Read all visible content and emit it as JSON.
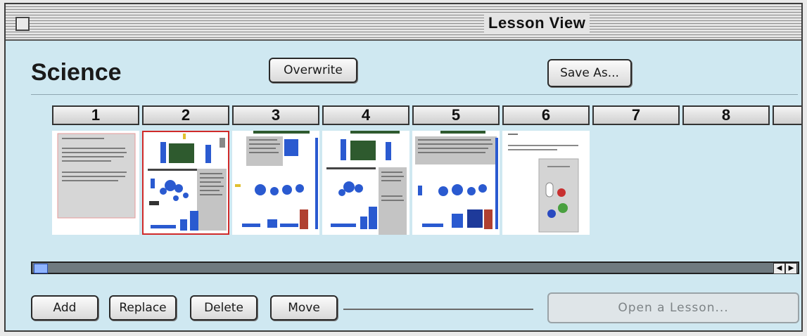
{
  "window": {
    "title": "Lesson View"
  },
  "subject": "Science",
  "buttons": {
    "overwrite": "Overwrite",
    "save_as": "Save As...",
    "add": "Add",
    "replace": "Replace",
    "delete": "Delete",
    "move": "Move",
    "open_lesson": "Open a Lesson..."
  },
  "columns": [
    "1",
    "2",
    "3",
    "4",
    "5",
    "6",
    "7",
    "8"
  ],
  "thumbnails": [
    {
      "index": 1,
      "selected": false
    },
    {
      "index": 2,
      "selected": true
    },
    {
      "index": 3,
      "selected": false
    },
    {
      "index": 4,
      "selected": false
    },
    {
      "index": 5,
      "selected": false
    },
    {
      "index": 6,
      "selected": false
    }
  ],
  "scroll": {
    "position": 0
  }
}
